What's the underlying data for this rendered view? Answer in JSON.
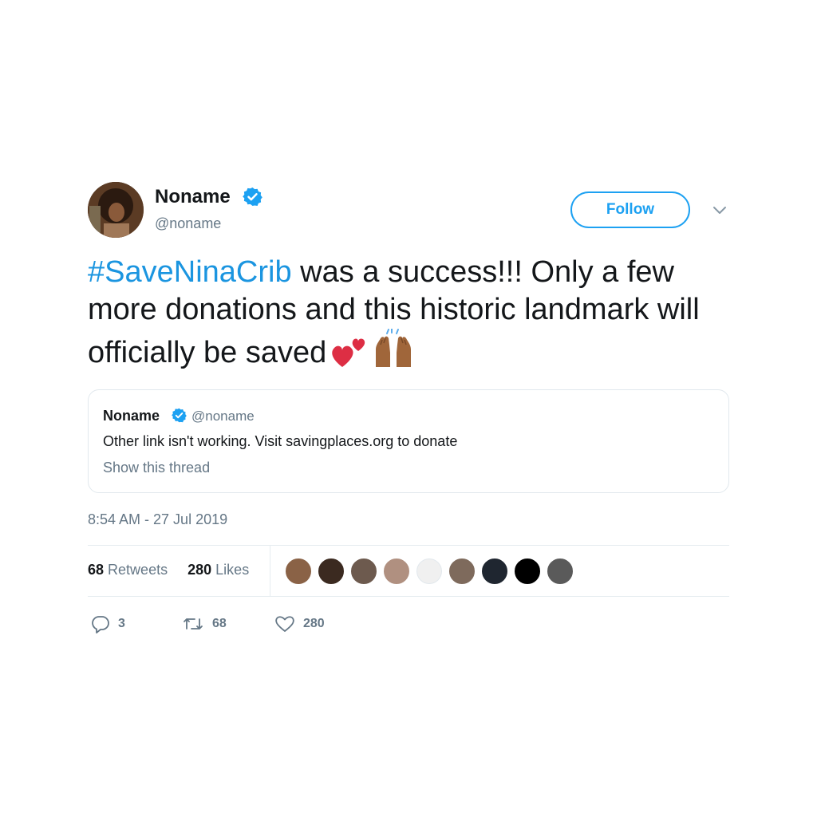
{
  "author": {
    "name": "Noname",
    "handle": "@noname",
    "verified": true
  },
  "follow_label": "Follow",
  "tweet": {
    "hashtag": "#SaveNinaCrib",
    "text": " was a success!!! Only a few more donations and this historic landmark will officially be saved",
    "emojis": [
      "two-hearts",
      "raising-hands-medium-dark"
    ]
  },
  "quote": {
    "name": "Noname",
    "handle": "@noname",
    "text": "Other link isn't working. Visit savingplaces.org to donate",
    "thread_label": "Show this thread"
  },
  "timestamp": "8:54 AM - 27 Jul 2019",
  "stats": {
    "retweets_count": "68",
    "retweets_label": "Retweets",
    "likes_count": "280",
    "likes_label": "Likes"
  },
  "likers": [
    {
      "color": "#8a6246"
    },
    {
      "color": "#3b2a20"
    },
    {
      "color": "#6d5a4e"
    },
    {
      "color": "#b09080"
    },
    {
      "color": "#f0f0f0"
    },
    {
      "color": "#7e6a5c"
    },
    {
      "color": "#1f2630"
    },
    {
      "color": "#000000"
    },
    {
      "color": "#5a5a5a"
    }
  ],
  "actions": {
    "reply_count": "3",
    "retweet_count": "68",
    "like_count": "280"
  },
  "colors": {
    "accent": "#1da1f2",
    "hashtag": "#1b95e0",
    "secondary_text": "#657786",
    "border": "#e1e8ed"
  }
}
